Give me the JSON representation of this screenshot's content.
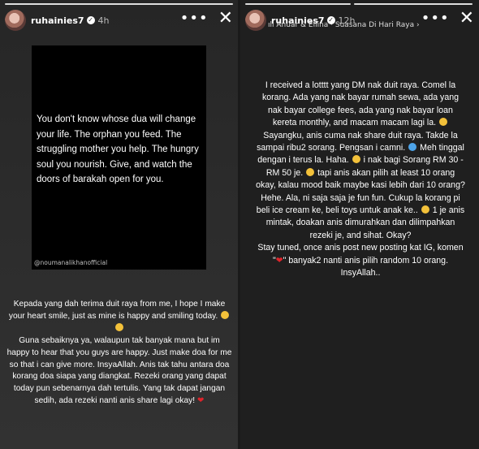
{
  "left_story": {
    "username": "ruhainies7",
    "time": "4h",
    "quote": {
      "text": "You don't know whose dua will change your life. The orphan you feed. The struggling mother you help. The hungry soul you nourish. Give, and watch the doors of barakah open for you.",
      "handle": "@noumanalikhanofficial"
    },
    "caption": {
      "p1": "Kepada yang dah terima duit raya from me, I hope I make your heart smile, just as mine is happy and smiling today.",
      "p2": "Guna sebaiknya ya, walaupun tak banyak mana but im happy to hear that you guys are happy. Just make doa for me so that i can give more. InsyaAllah. Anis tak tahu antara doa korang doa siapa yang diangkat. Rezeki orang yang dapat today pun sebenarnya dah tertulis. Yang tak dapat jangan sedih, ada rezeki nanti anis share lagi okay!"
    }
  },
  "right_story": {
    "username": "ruhainies7",
    "time": "12h",
    "music": "Anuar & Ellina · Suasana Di Hari Raya",
    "caption": {
      "p1": "I received a lotttt yang DM nak duit raya. Comel la korang. Ada yang nak bayar rumah sewa, ada yang nak bayar college fees, ada yang nak bayar loan kereta monthly, and macam macam lagi la.",
      "p2a": "Sayangku, anis cuma nak share duit raya. Takde la sampai ribu2 sorang. Pengsan i camni.",
      "p2b": "Meh tinggal dengan i terus la. Haha.",
      "p2c": "i nak bagi Sorang RM 30 - RM 50 je.",
      "p2d": "tapi anis akan pilih at least 10 orang okay, kalau mood baik maybe kasi lebih dari 10 orang? Hehe. Ala, ni saja saja je fun fun. Cukup la korang pi beli ice cream ke, beli toys untuk anak ke..",
      "p2e": "1 je anis mintak, doakan anis dimurahkan dan dilimpahkan rezeki je, and sihat. Okay?",
      "p3a": "Stay tuned, once anis post new posting kat IG, komen \"",
      "heart": "❤",
      "p3b": "\" banyak2 nanti anis pilih random 10 orang. InsyAllah.."
    }
  },
  "colors": {
    "heart": "#e0242b"
  }
}
